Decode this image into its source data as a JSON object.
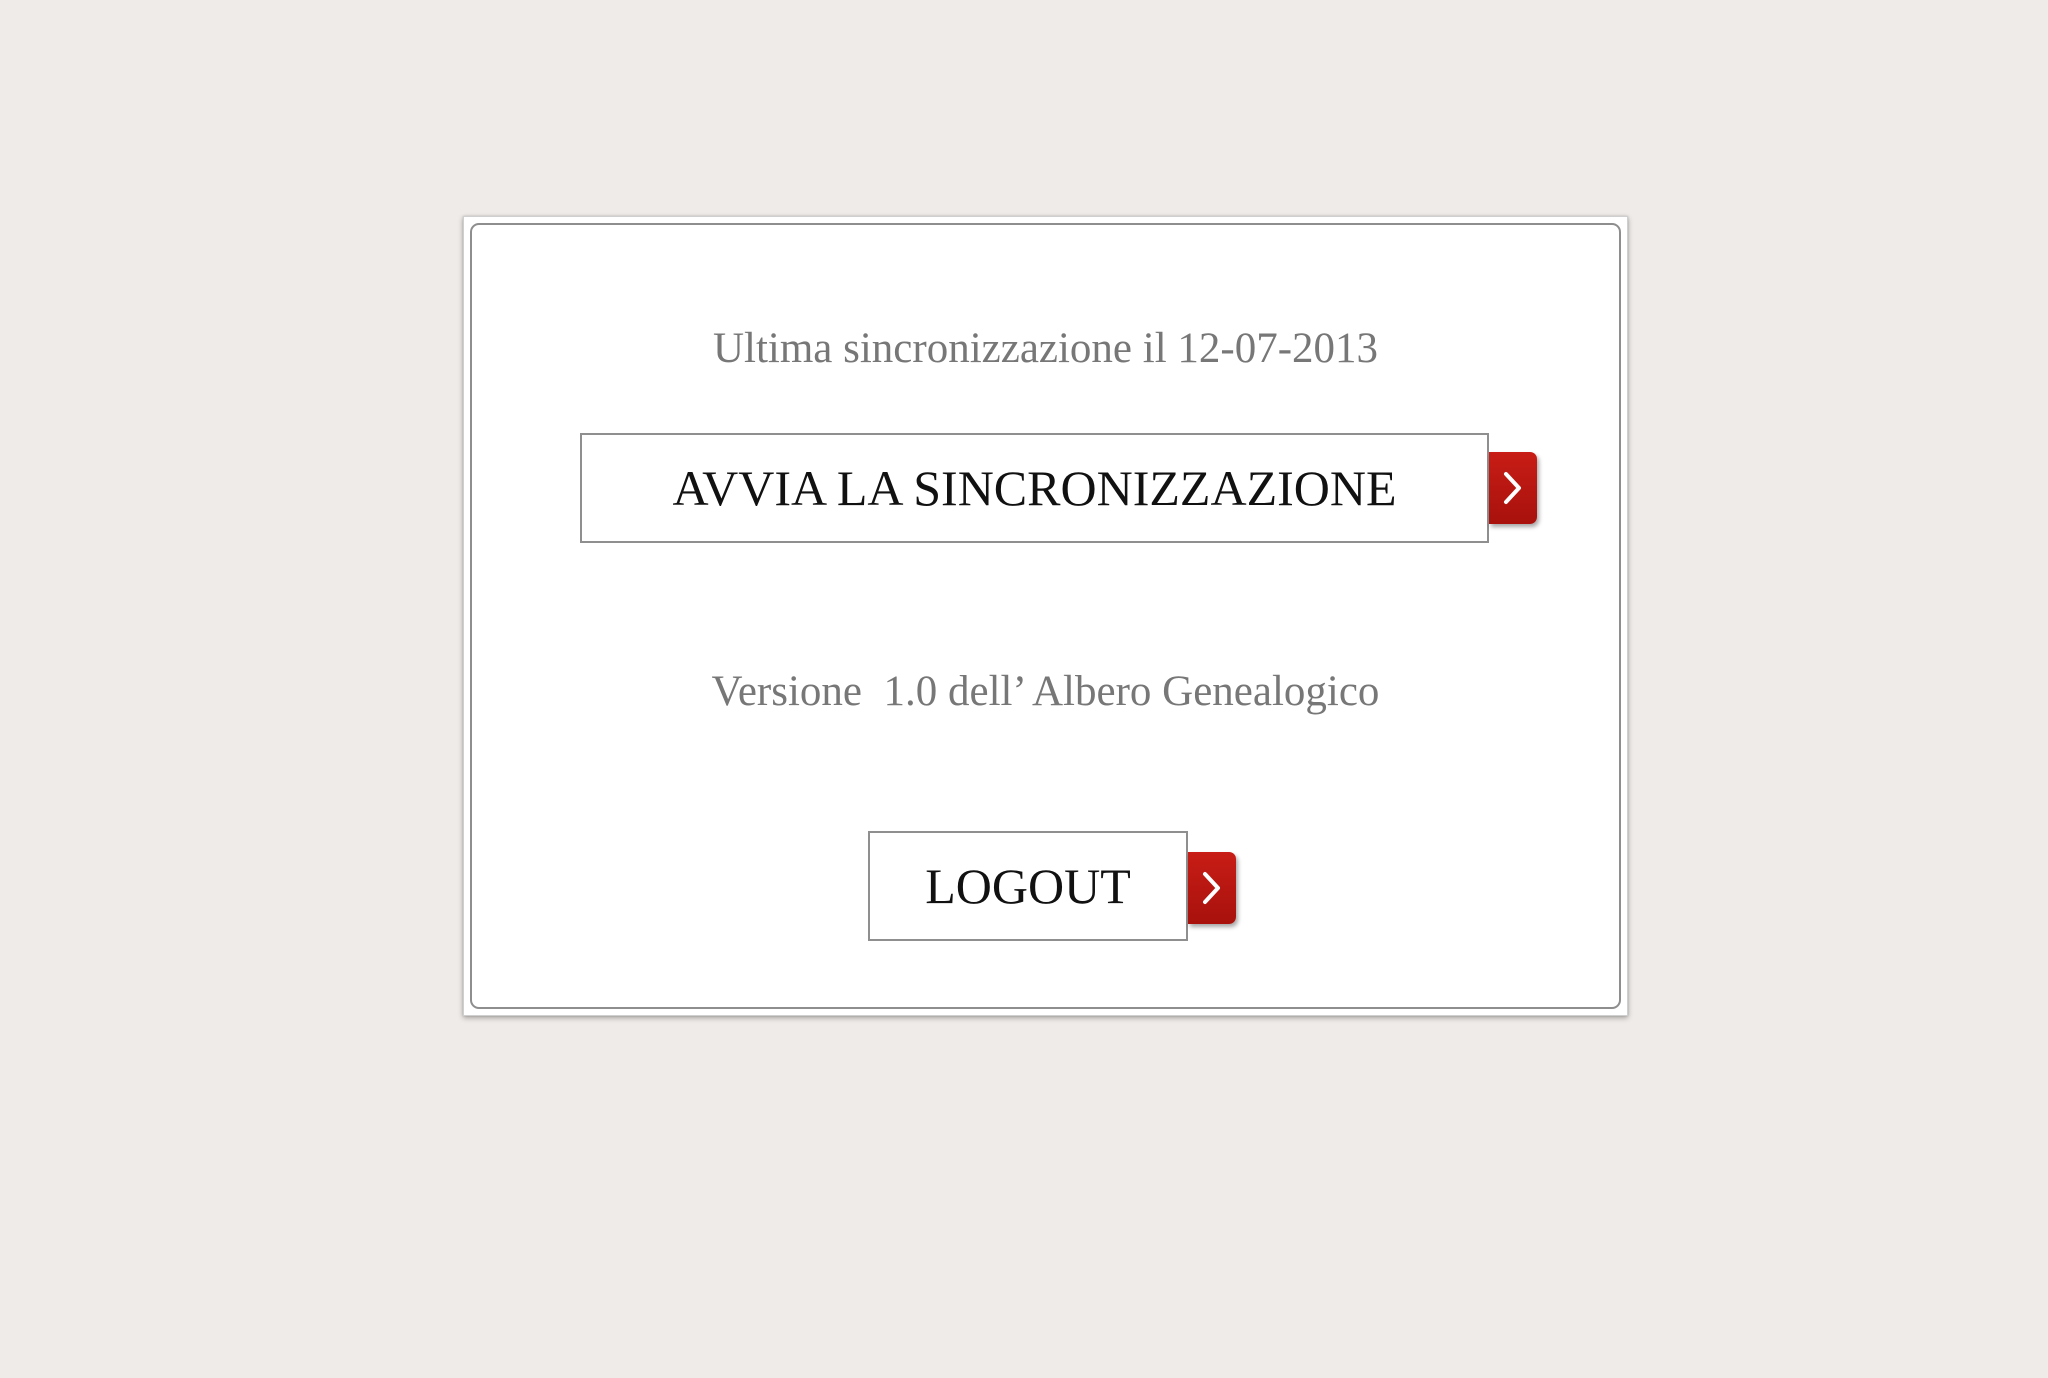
{
  "settings": {
    "last_sync_text": "Ultima sincronizzazione il 12-07-2013",
    "sync_button_label": "AVVIA LA SINCRONIZZAZIONE",
    "version_text": "Versione  1.0 dell’ Albero Genealogico",
    "logout_button_label": "LOGOUT"
  },
  "icons": {
    "sync_arrow": "chevron-right-icon",
    "logout_arrow": "chevron-right-icon"
  },
  "colors": {
    "background": "#efebe8",
    "card": "#ffffff",
    "accent": "#b8140f",
    "muted_text": "#777777",
    "button_text": "#111111"
  }
}
